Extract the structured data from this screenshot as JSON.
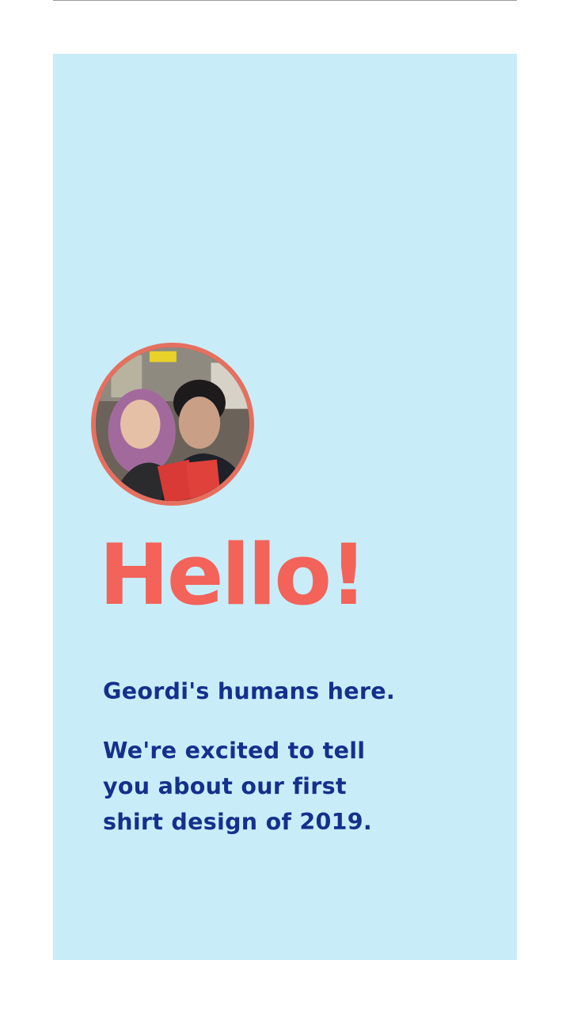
{
  "card": {
    "background": "#c8edf8",
    "accent": "#f3635a",
    "text_color": "#14308d",
    "avatar_ring": "#e5705f"
  },
  "avatar": {
    "icon": "couple-photo-avatar"
  },
  "greeting": "Hello!",
  "intro": "Geordi's humans here.",
  "message_lines": [
    "We're excited to tell",
    "you about our first",
    "shirt design of 2019."
  ]
}
